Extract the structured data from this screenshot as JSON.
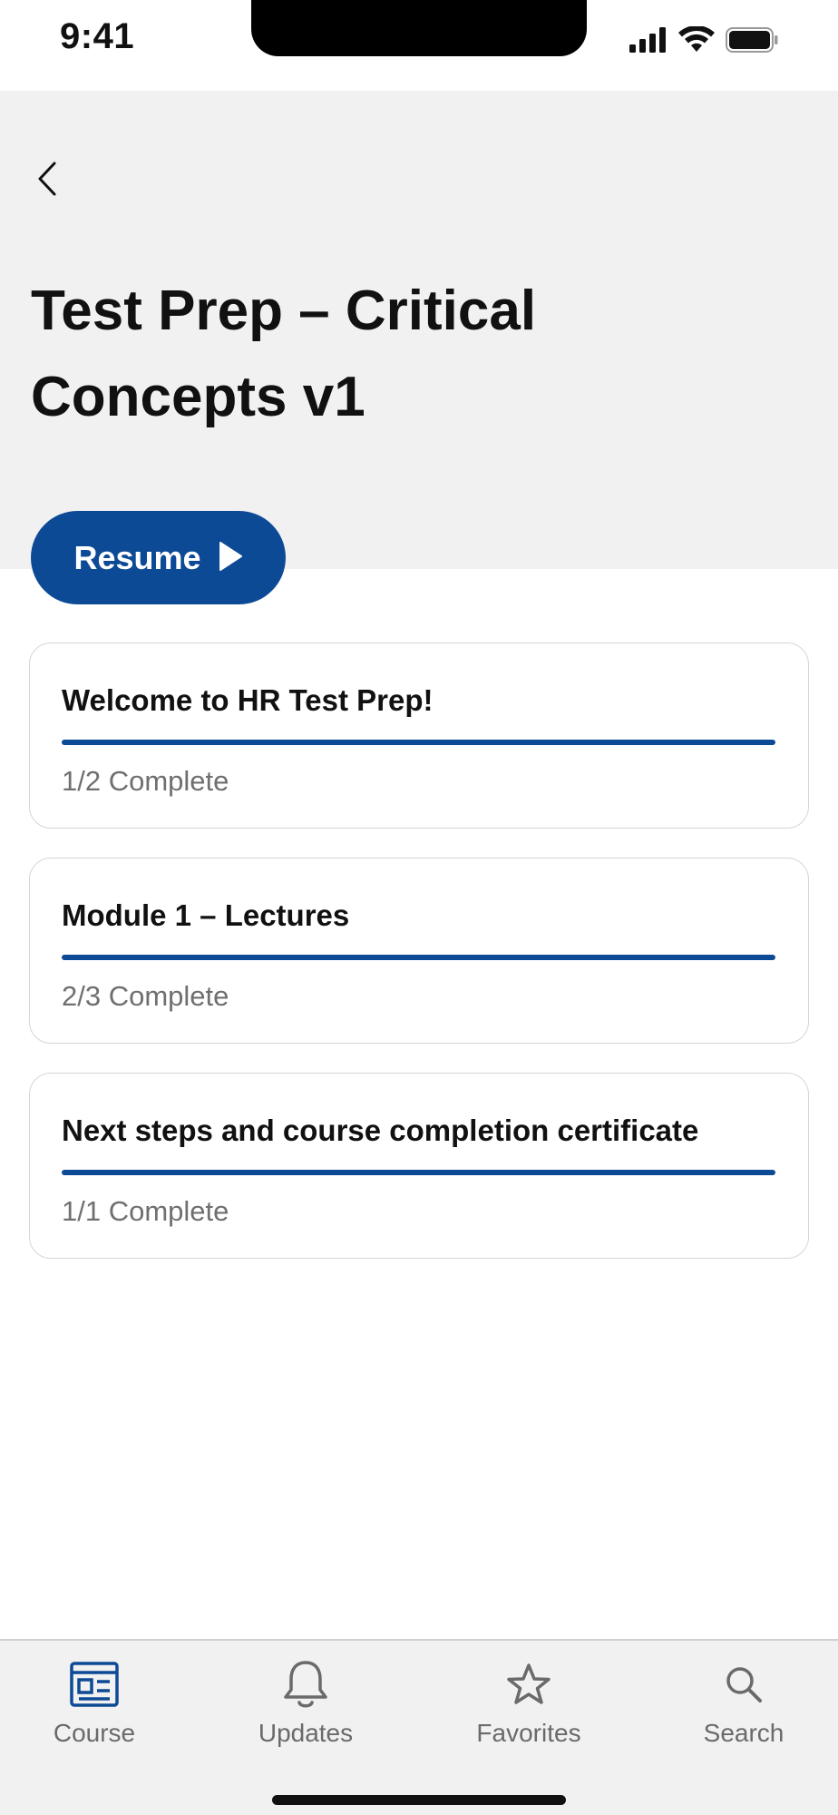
{
  "status_bar": {
    "time": "9:41",
    "icons": [
      "cellular-signal-icon",
      "wifi-icon",
      "battery-icon"
    ]
  },
  "header": {
    "back_icon": "chevron-left-icon",
    "title": "Test Prep – Critical Concepts v1",
    "background": "#f1f1f1"
  },
  "resume_button": {
    "label": "Resume",
    "icon": "play-icon",
    "color": "#0d4a96"
  },
  "modules": [
    {
      "title": "Welcome to HR Test Prep!",
      "status": "1/2 Complete",
      "progress": 1.0
    },
    {
      "title": "Module 1 – Lectures",
      "status": "2/3 Complete",
      "progress": 1.0
    },
    {
      "title": "Next steps and course completion certificate",
      "status": "1/1 Complete",
      "progress": 1.0
    }
  ],
  "tab_bar": {
    "tabs": [
      {
        "label": "Course",
        "icon": "course-icon",
        "active": true
      },
      {
        "label": "Updates",
        "icon": "bell-icon",
        "active": false
      },
      {
        "label": "Favorites",
        "icon": "star-icon",
        "active": false
      },
      {
        "label": "Search",
        "icon": "search-icon",
        "active": false
      }
    ]
  },
  "colors": {
    "accent": "#0d4a96",
    "muted_text": "#6f6f6f",
    "tab_inactive": "#6a6a6a"
  }
}
